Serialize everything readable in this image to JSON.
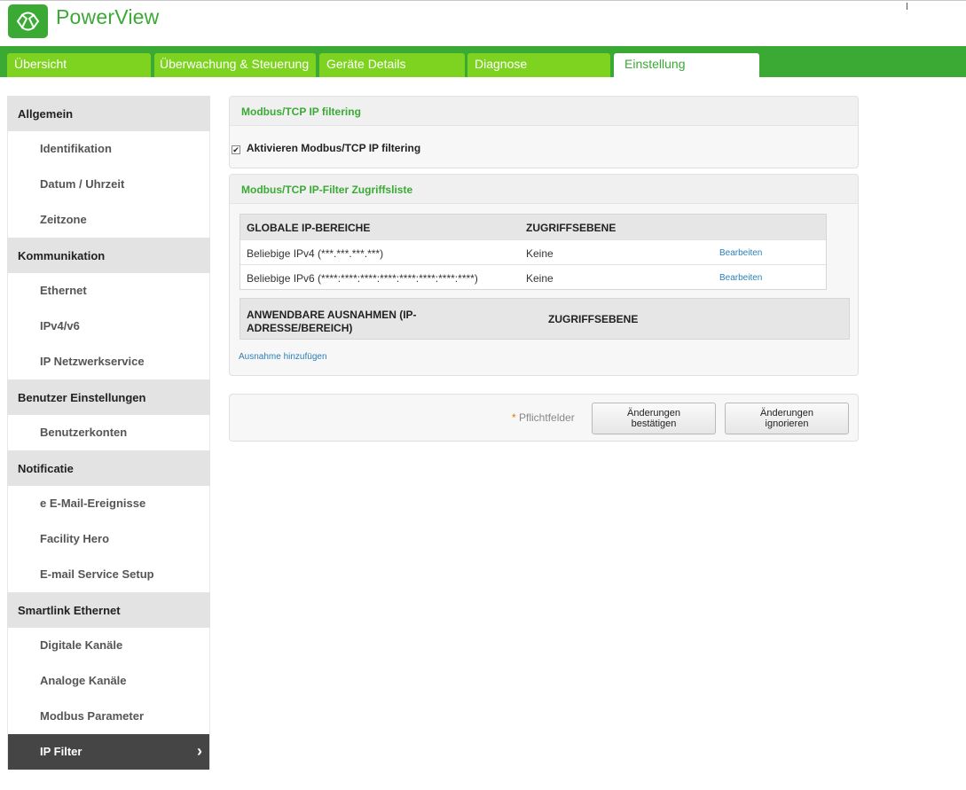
{
  "app": {
    "brand": "PowerView"
  },
  "tabs": [
    {
      "label": "Übersicht",
      "active": false
    },
    {
      "label": "Überwachung & Steuerung",
      "active": false
    },
    {
      "label": "Geräte Details",
      "active": false
    },
    {
      "label": "Diagnose",
      "active": false
    },
    {
      "label": "Einstellung",
      "active": true
    }
  ],
  "sidebar": {
    "sections": [
      {
        "heading": "Allgemein",
        "items": [
          "Identifikation",
          "Datum / Uhrzeit",
          "Zeitzone"
        ]
      },
      {
        "heading": "Kommunikation",
        "items": [
          "Ethernet",
          "IPv4/v6",
          "IP Netzwerkservice"
        ]
      },
      {
        "heading": "Benutzer Einstellungen",
        "items": [
          "Benutzerkonten"
        ]
      },
      {
        "heading": "Notificatie",
        "items": [
          "e E-Mail-Ereignisse",
          "Facility Hero",
          "E-mail Service Setup"
        ]
      },
      {
        "heading": "Smartlink Ethernet",
        "items": [
          "Digitale Kanäle",
          "Analoge Kanäle",
          "Modbus Parameter",
          "IP Filter"
        ]
      }
    ],
    "active_item": "IP Filter"
  },
  "filtering_panel": {
    "title": "Modbus/TCP IP filtering",
    "checkbox_label": "Aktivieren Modbus/TCP IP filtering",
    "checkbox_checked": true
  },
  "access_panel": {
    "title": "Modbus/TCP IP-Filter Zugriffsliste",
    "global_table": {
      "headers": [
        "GLOBALE IP-BEREICHE",
        "ZUGRIFFSEBENE"
      ],
      "rows": [
        {
          "range": "Beliebige IPv4 (***.***.***.***)",
          "level": "Keine",
          "action": "Bearbeiten"
        },
        {
          "range": "Beliebige IPv6 (****:****:****:****:****:****:****:****)",
          "level": "Keine",
          "action": "Bearbeiten"
        }
      ]
    },
    "exceptions_table": {
      "headers": [
        "ANWENDBARE AUSNAHMEN (IP-ADRESSE/BEREICH)",
        "ZUGRIFFSEBENE"
      ]
    },
    "add_exception_link": "Ausnahme hinzufügen"
  },
  "actions": {
    "required_marker": "*",
    "required_label": "Pflichtfelder",
    "confirm_line1": "Änderungen",
    "confirm_line2": "bestätigen",
    "ignore_line1": "Änderungen",
    "ignore_line2": "ignorieren"
  },
  "colors": {
    "brand_green": "#3aaa35",
    "tab_green": "#7ed321",
    "link_blue": "#2c7fb8",
    "active_dark": "#454545"
  }
}
